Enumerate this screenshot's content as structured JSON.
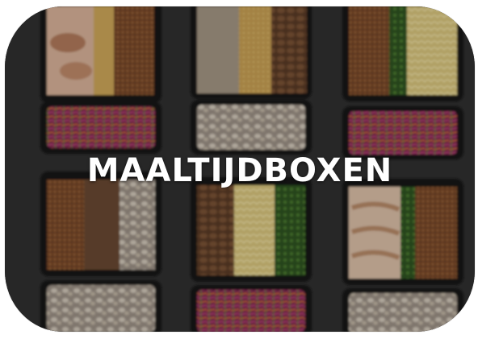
{
  "banner": {
    "title": "MAALTIJDBOXEN",
    "image": {
      "description_icon": "meal-prep-containers-photo",
      "background_color": "#2a2a2a",
      "tray_color": "#151515",
      "food_colors": {
        "chicken": "#d9b39a",
        "rice": "#cfa85a",
        "grain": "#7a4a2a",
        "greens": "#3f6b2a",
        "cabbage": "#8b2f5a",
        "carrot": "#d96a2a",
        "mushroom": "#c9c0b0",
        "noodles": "#e2cf8a"
      }
    }
  }
}
